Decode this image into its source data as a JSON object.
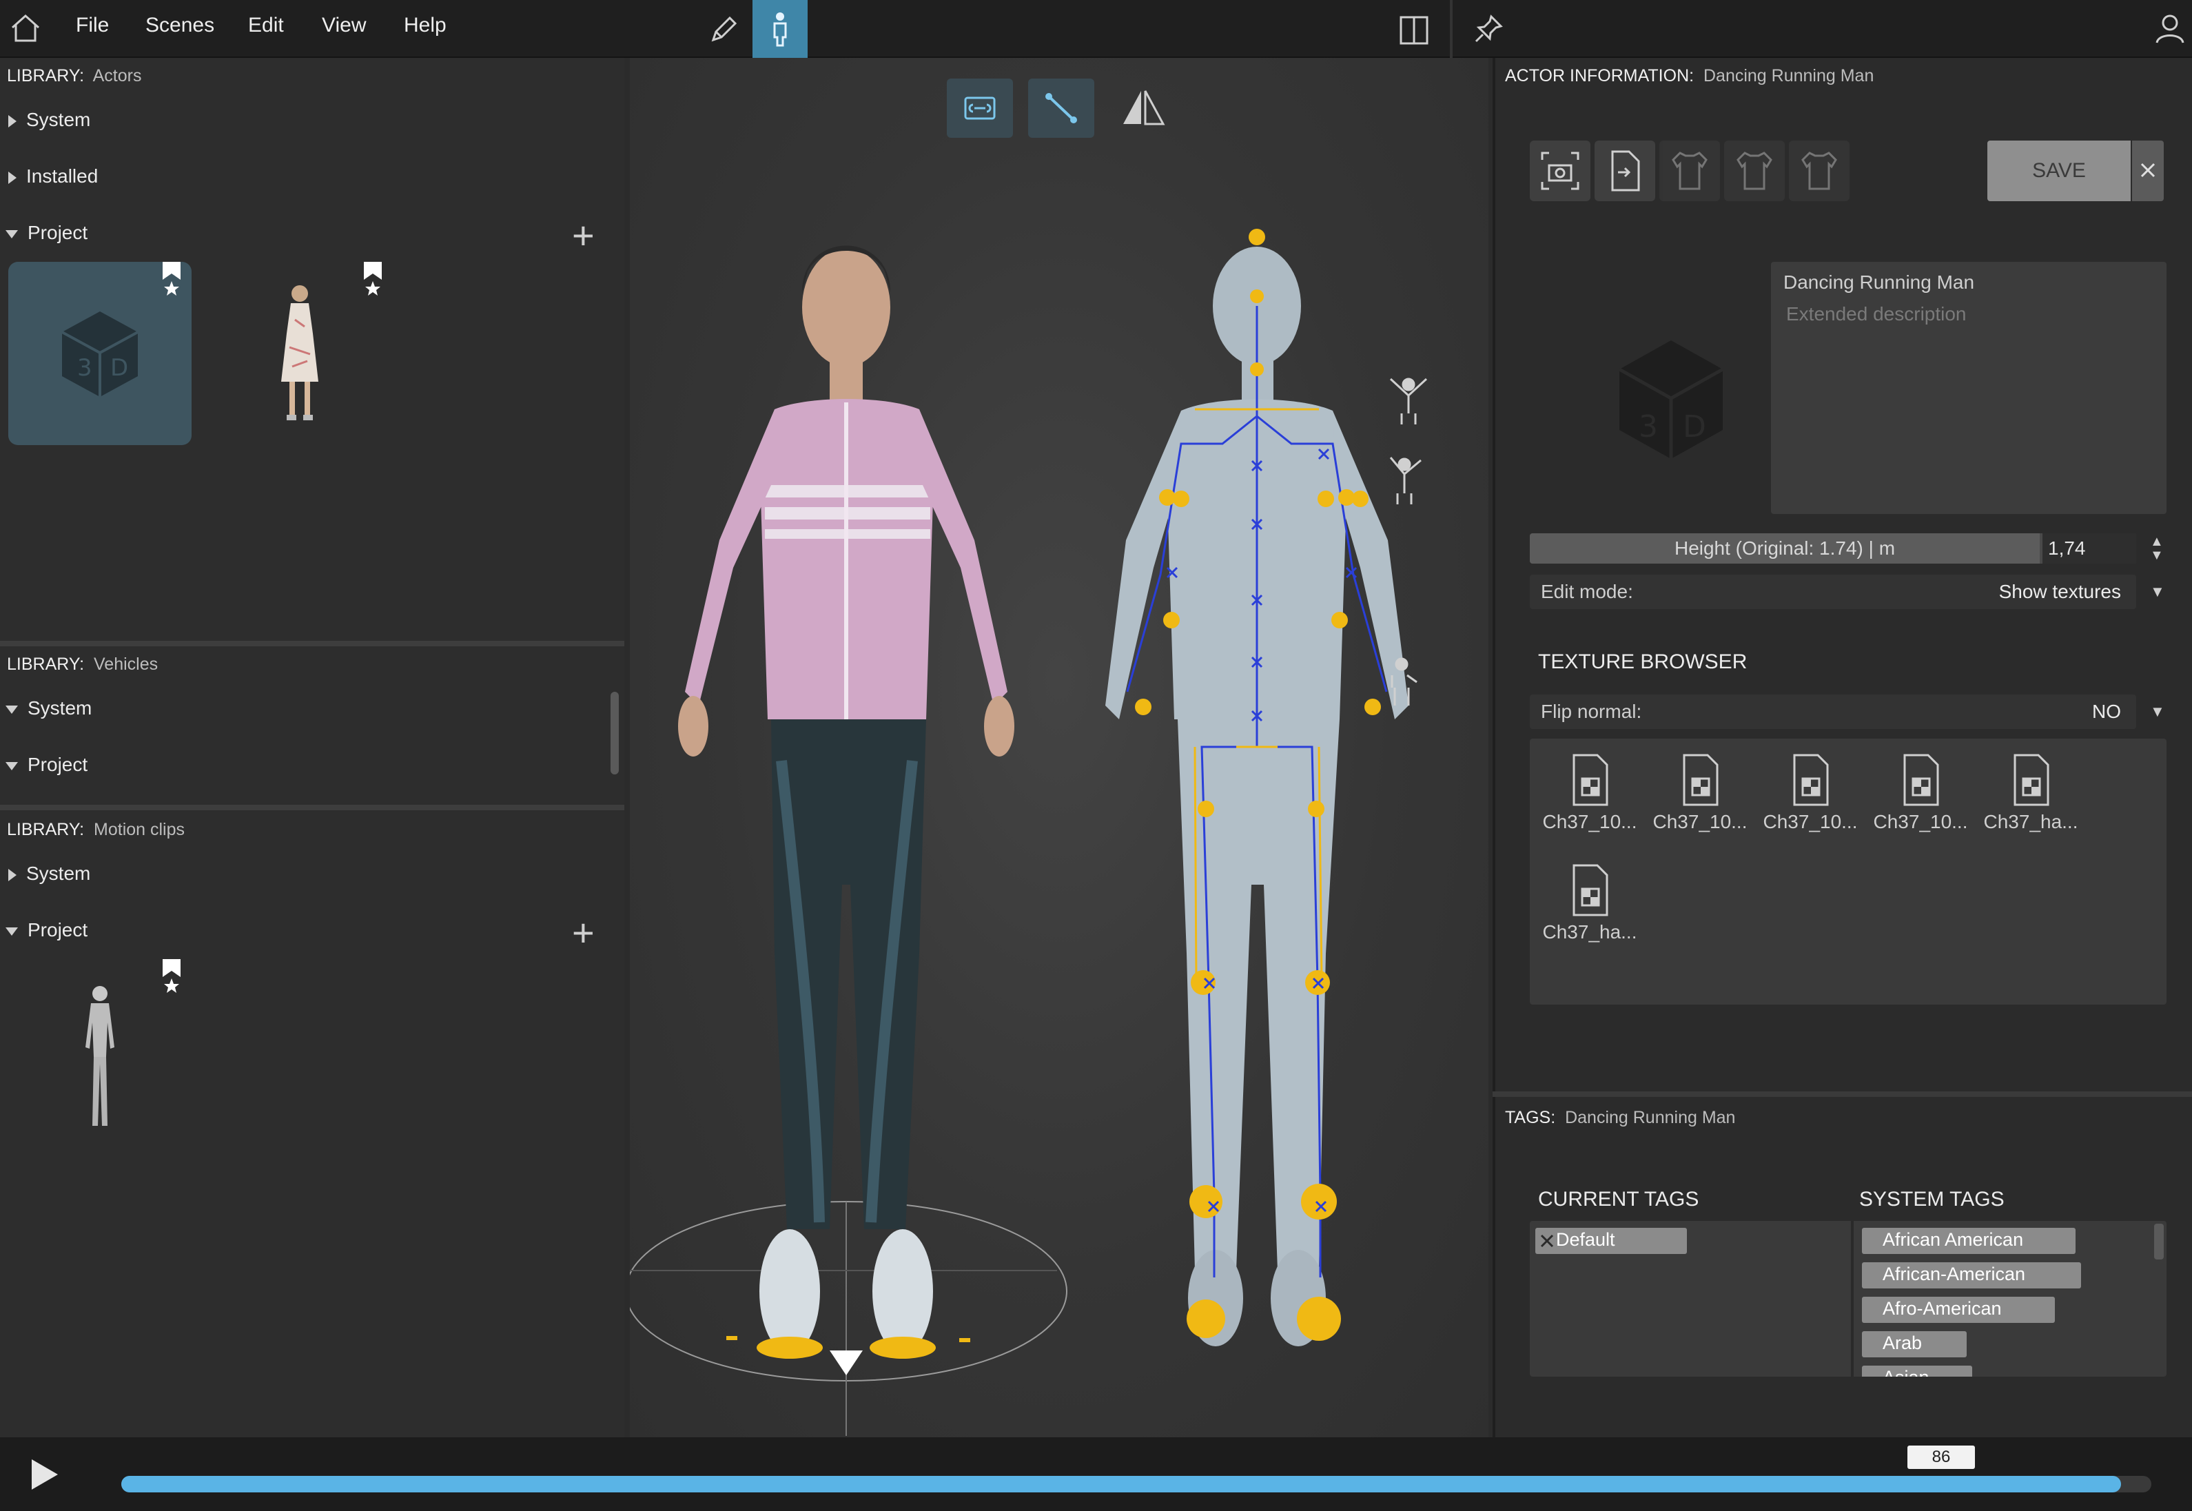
{
  "menu": {
    "file": "File",
    "scenes": "Scenes",
    "edit": "Edit",
    "view": "View",
    "help": "Help"
  },
  "left_panel": {
    "actors": {
      "label": "LIBRARY:",
      "name": "Actors",
      "tree": [
        "System",
        "Installed",
        "Project"
      ]
    },
    "vehicles": {
      "label": "LIBRARY:",
      "name": "Vehicles",
      "tree": [
        "System",
        "Project"
      ]
    },
    "motion_clips": {
      "label": "LIBRARY:",
      "name": "Motion clips",
      "tree": [
        "System",
        "Project"
      ]
    }
  },
  "actor_info": {
    "label": "ACTOR INFORMATION:",
    "name": "Dancing Running Man",
    "save": "SAVE",
    "description_title": "Dancing Running Man",
    "description_placeholder": "Extended description",
    "height_label": "Height (Original: 1.74) | m",
    "height_value": "1,74",
    "edit_mode_label": "Edit mode:",
    "edit_mode_value": "Show textures",
    "texture_browser": "TEXTURE BROWSER",
    "flip_label": "Flip normal:",
    "flip_value": "NO",
    "textures": [
      "Ch37_10...",
      "Ch37_10...",
      "Ch37_10...",
      "Ch37_10...",
      "Ch37_ha...",
      "Ch37_ha..."
    ]
  },
  "tags": {
    "label": "TAGS:",
    "name": "Dancing Running Man",
    "current_title": "CURRENT TAGS",
    "system_title": "SYSTEM TAGS",
    "current": [
      "Default"
    ],
    "system": [
      "African American",
      "African-American",
      "Afro-American",
      "Arab",
      "Asian"
    ]
  },
  "timeline": {
    "frame": "86",
    "progress": 0.985
  },
  "colors": {
    "accent": "#3f9fd0",
    "timeline": "#5ab4e6",
    "joint": "#f0b914",
    "bone": "#2a3fd8"
  }
}
